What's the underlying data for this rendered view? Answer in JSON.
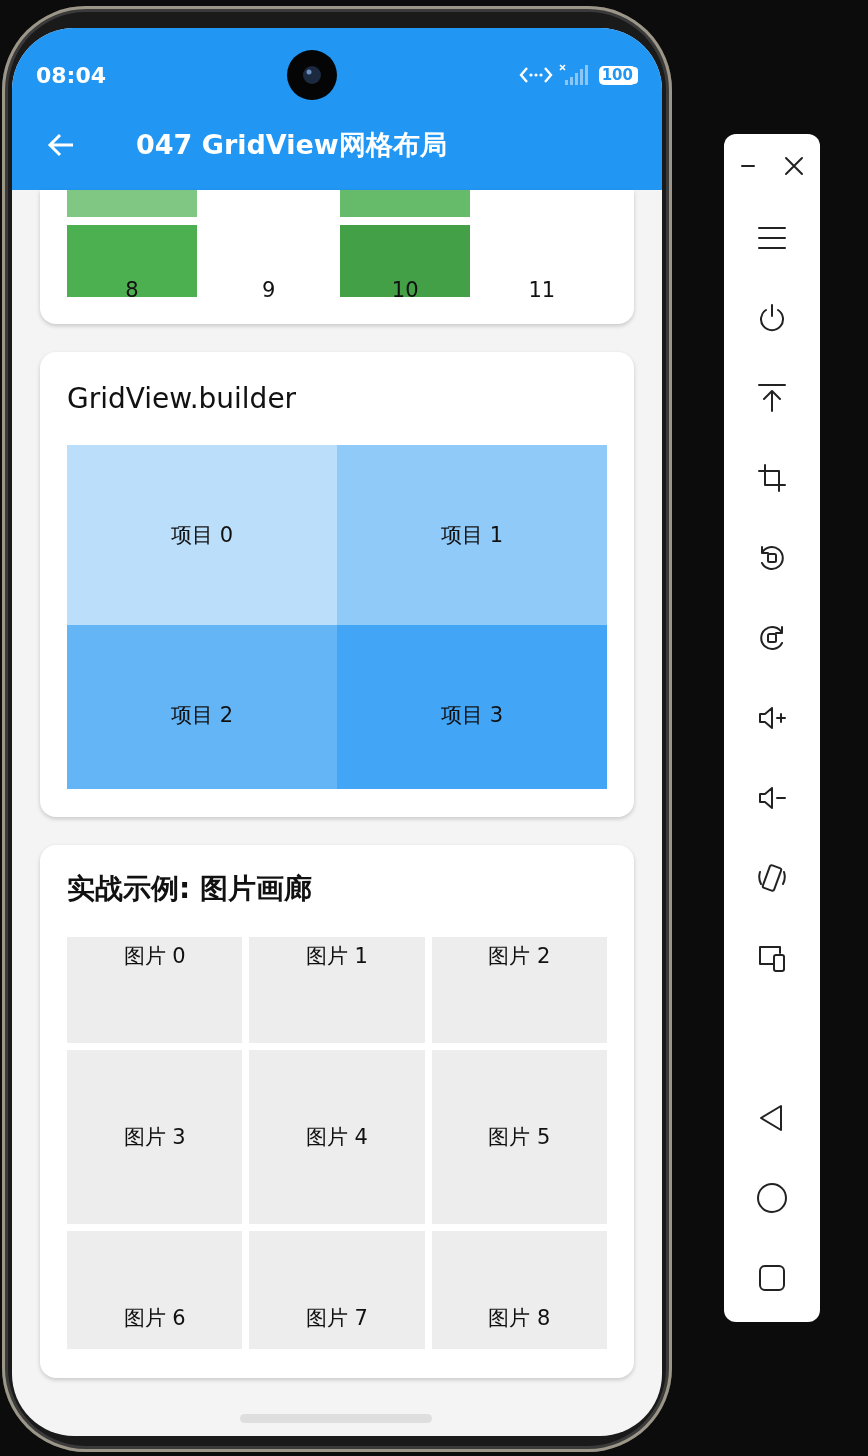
{
  "status_bar": {
    "time": "08:04",
    "battery": "100"
  },
  "app_bar": {
    "title": "047 GridView网格布局"
  },
  "cards": [
    {
      "kind": "color_grid",
      "tiles": [
        {
          "kind": "filled",
          "color": "#81c784"
        },
        {
          "kind": "empty"
        },
        {
          "kind": "filled",
          "color": "#66bb6a"
        },
        {
          "kind": "empty"
        },
        {
          "kind": "filled",
          "label": "8",
          "color": "#4caf50"
        },
        {
          "kind": "plain",
          "label": "9"
        },
        {
          "kind": "filled",
          "label": "10",
          "color": "#43a047"
        },
        {
          "kind": "plain",
          "label": "11"
        }
      ]
    },
    {
      "kind": "builder",
      "title": "GridView.builder",
      "items": [
        {
          "label": "项目 0",
          "color": "#bbdefb"
        },
        {
          "label": "项目 1",
          "color": "#90caf9"
        },
        {
          "label": "项目 2",
          "color": "#64b5f6"
        },
        {
          "label": "项目 3",
          "color": "#42a5f5"
        }
      ]
    },
    {
      "kind": "gallery",
      "title": "实战示例: 图片画廊",
      "items": [
        {
          "label": "图片 0"
        },
        {
          "label": "图片 1"
        },
        {
          "label": "图片 2"
        },
        {
          "label": "图片 3"
        },
        {
          "label": "图片 4"
        },
        {
          "label": "图片 5"
        },
        {
          "label": "图片 6"
        },
        {
          "label": "图片 7"
        },
        {
          "label": "图片 8"
        }
      ]
    }
  ]
}
